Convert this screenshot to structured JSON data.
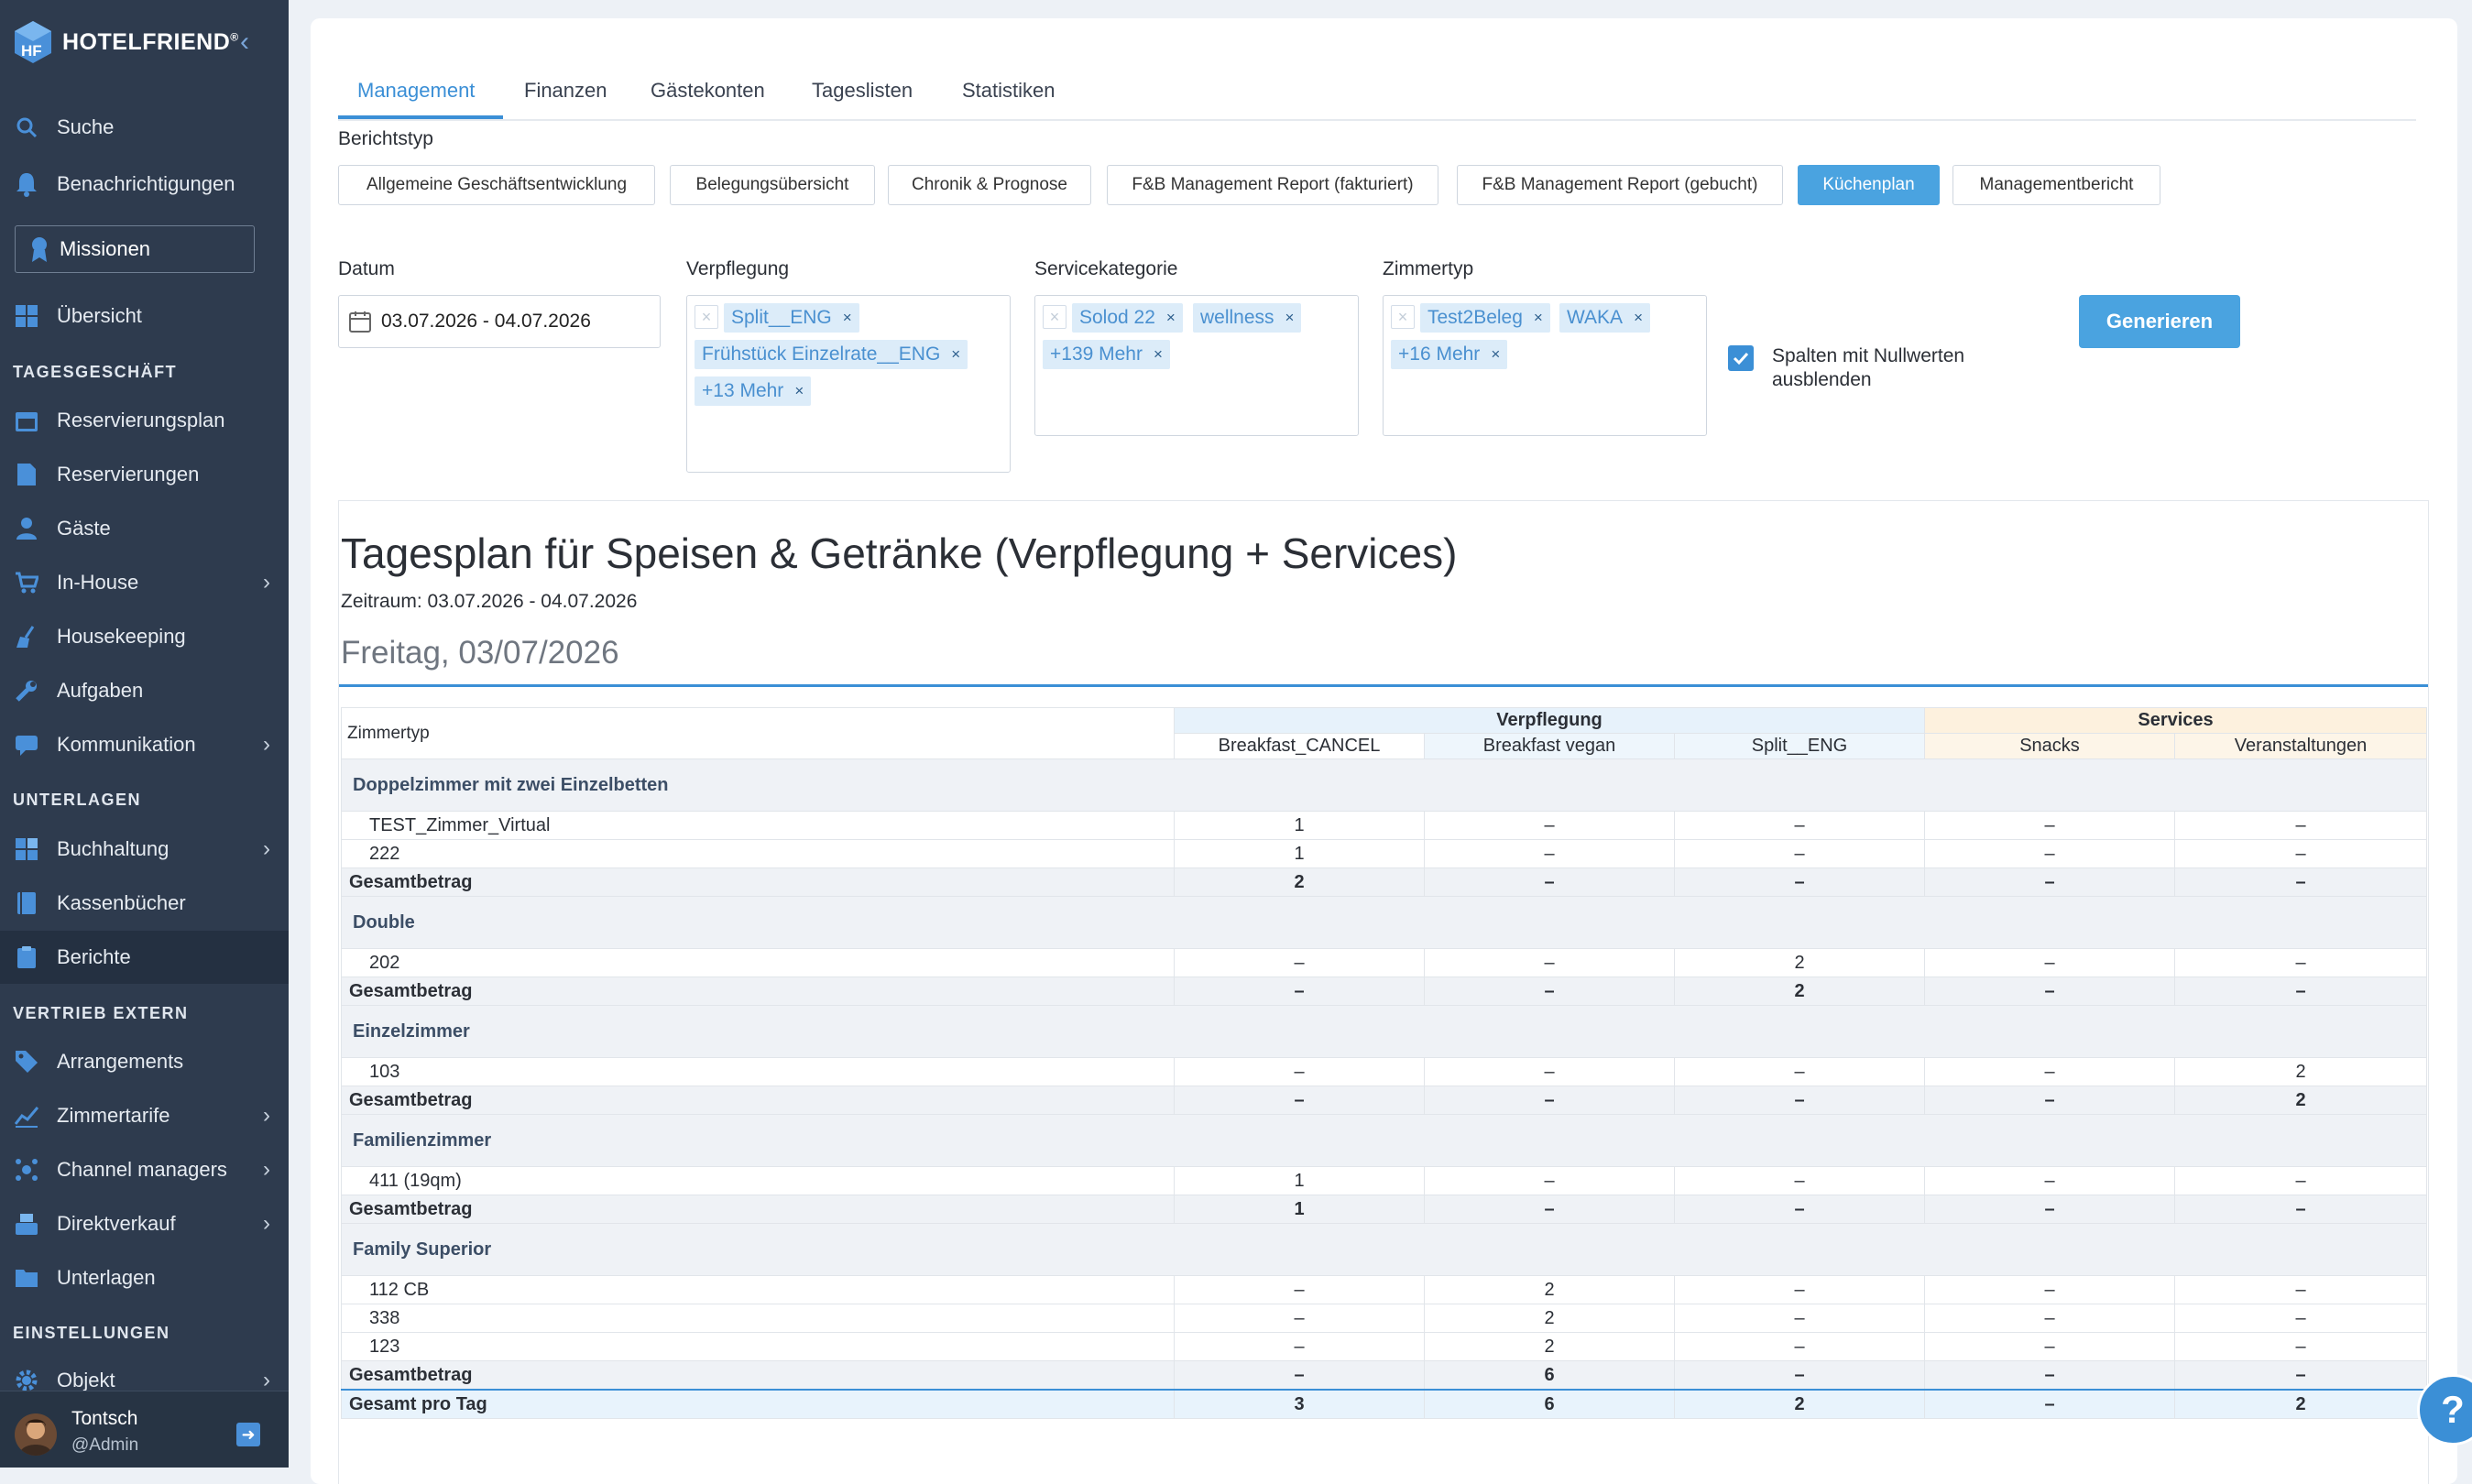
{
  "brand": {
    "name": "HOTELFRIEND",
    "mark": "®"
  },
  "sidebar": {
    "search": "Suche",
    "notifications": "Benachrichtigungen",
    "missions": "Missionen",
    "overview": "Übersicht",
    "sections": {
      "tagesgeschaeft": "TAGESGESCHÄFT",
      "unterlagen": "UNTERLAGEN",
      "vertrieb": "VERTRIEB EXTERN",
      "einstellungen": "EINSTELLUNGEN"
    },
    "items": {
      "reservierungsplan": "Reservierungsplan",
      "reservierungen": "Reservierungen",
      "gaeste": "Gäste",
      "inhouse": "In-House",
      "housekeeping": "Housekeeping",
      "aufgaben": "Aufgaben",
      "kommunikation": "Kommunikation",
      "buchhaltung": "Buchhaltung",
      "kassenbuecher": "Kassenbücher",
      "berichte": "Berichte",
      "arrangements": "Arrangements",
      "zimmertarife": "Zimmertarife",
      "channel": "Channel managers",
      "direktverkauf": "Direktverkauf",
      "unterlagen": "Unterlagen",
      "objekt": "Objekt"
    },
    "user": {
      "name": "Tontsch",
      "role": "@Admin"
    }
  },
  "tabs": [
    "Management",
    "Finanzen",
    "Gästekonten",
    "Tageslisten",
    "Statistiken"
  ],
  "filters": {
    "berichtstyp_label": "Berichtstyp",
    "report_types": [
      "Allgemeine Geschäftsentwicklung",
      "Belegungsübersicht",
      "Chronik & Prognose",
      "F&B Management Report (fakturiert)",
      "F&B Management Report (gebucht)",
      "Küchenplan",
      "Managementbericht"
    ],
    "datum_label": "Datum",
    "datum_value": "03.07.2026 - 04.07.2026",
    "verpflegung_label": "Verpflegung",
    "verpflegung_chips": [
      "Split__ENG",
      "Frühstück Einzelrate__ENG",
      "+13 Mehr"
    ],
    "service_label": "Servicekategorie",
    "service_chips": [
      "Solod 22",
      "wellness",
      "+139 Mehr"
    ],
    "zimmertyp_label": "Zimmertyp",
    "zimmertyp_chips": [
      "Test2Beleg",
      "WAKA",
      "+16 Mehr"
    ],
    "checkbox_label": "Spalten mit Nullwerten ausblenden",
    "checkbox_checked": true,
    "generate": "Generieren"
  },
  "report": {
    "title": "Tagesplan für Speisen & Getränke (Verpflegung + Services)",
    "period": "Zeitraum: 03.07.2026 - 04.07.2026",
    "day": "Freitag, 03/07/2026",
    "table": {
      "zimmertyp_header": "Zimmertyp",
      "groups": {
        "verpflegung": "Verpflegung",
        "services": "Services"
      },
      "columns": [
        "Breakfast_CANCEL",
        "Breakfast vegan",
        "Split__ENG",
        "Snacks",
        "Veranstaltungen"
      ],
      "categories": [
        {
          "name": "Doppelzimmer mit zwei Einzelbetten",
          "rows": [
            {
              "name": "TEST_Zimmer_Virtual",
              "values": [
                "1",
                "–",
                "–",
                "–",
                "–"
              ]
            },
            {
              "name": "222",
              "values": [
                "1",
                "–",
                "–",
                "–",
                "–"
              ]
            }
          ],
          "sum": {
            "label": "Gesamtbetrag",
            "values": [
              "2",
              "–",
              "–",
              "–",
              "–"
            ]
          }
        },
        {
          "name": "Double",
          "rows": [
            {
              "name": "202",
              "values": [
                "–",
                "–",
                "2",
                "–",
                "–"
              ]
            }
          ],
          "sum": {
            "label": "Gesamtbetrag",
            "values": [
              "–",
              "–",
              "2",
              "–",
              "–"
            ]
          }
        },
        {
          "name": "Einzelzimmer",
          "rows": [
            {
              "name": "103",
              "values": [
                "–",
                "–",
                "–",
                "–",
                "2"
              ]
            }
          ],
          "sum": {
            "label": "Gesamtbetrag",
            "values": [
              "–",
              "–",
              "–",
              "–",
              "2"
            ]
          }
        },
        {
          "name": "Familienzimmer",
          "rows": [
            {
              "name": "411 (19qm)",
              "values": [
                "1",
                "–",
                "–",
                "–",
                "–"
              ]
            }
          ],
          "sum": {
            "label": "Gesamtbetrag",
            "values": [
              "1",
              "–",
              "–",
              "–",
              "–"
            ]
          }
        },
        {
          "name": "Family Superior",
          "rows": [
            {
              "name": "112 CB",
              "values": [
                "–",
                "2",
                "–",
                "–",
                "–"
              ]
            },
            {
              "name": "338",
              "values": [
                "–",
                "2",
                "–",
                "–",
                "–"
              ]
            },
            {
              "name": "123",
              "values": [
                "–",
                "2",
                "–",
                "–",
                "–"
              ]
            }
          ],
          "sum": {
            "label": "Gesamtbetrag",
            "values": [
              "–",
              "6",
              "–",
              "–",
              "–"
            ]
          }
        }
      ],
      "total": {
        "label": "Gesamt pro Tag",
        "values": [
          "3",
          "6",
          "2",
          "–",
          "2"
        ]
      }
    }
  },
  "help": "?",
  "colors": {
    "sidebar": "#2e3b4e",
    "accent": "#3b8fd6",
    "button": "#4aa3e0",
    "chip": "#dcecf9",
    "verpflegung": "#e7f2fb",
    "services": "#fdf1de"
  }
}
